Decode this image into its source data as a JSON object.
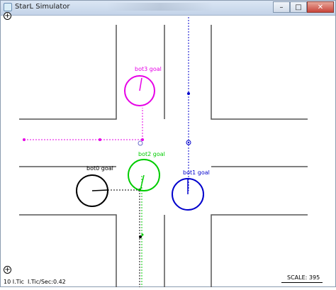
{
  "window": {
    "title": "StarL Simulator",
    "minimize_glyph": "–",
    "maximize_glyph": "□",
    "close_glyph": "✕"
  },
  "zoom": {
    "zoom_in_glyph": "+",
    "zoom_out_glyph": "+",
    "icon": "zoom-plus-icon"
  },
  "status": {
    "tic": "10 I.Tic",
    "rate": "I.Tic/Sec:0.42"
  },
  "scale": {
    "label": "SCALE: 395"
  },
  "robots": [
    {
      "name": "bot0",
      "goal_label": "bot0 goal",
      "color": "#000000",
      "heading": "east"
    },
    {
      "name": "bot1",
      "goal_label": "bot1 goal",
      "color": "#0000cc",
      "heading": "north"
    },
    {
      "name": "bot2",
      "goal_label": "bot2 goal",
      "color": "#00cc00",
      "heading": "south-southwest"
    },
    {
      "name": "bot3",
      "goal_label": "bot3 goal",
      "color": "#e600e6",
      "heading": "north"
    }
  ],
  "colors": {
    "road_edges": "#555555",
    "background": "#ffffff"
  }
}
